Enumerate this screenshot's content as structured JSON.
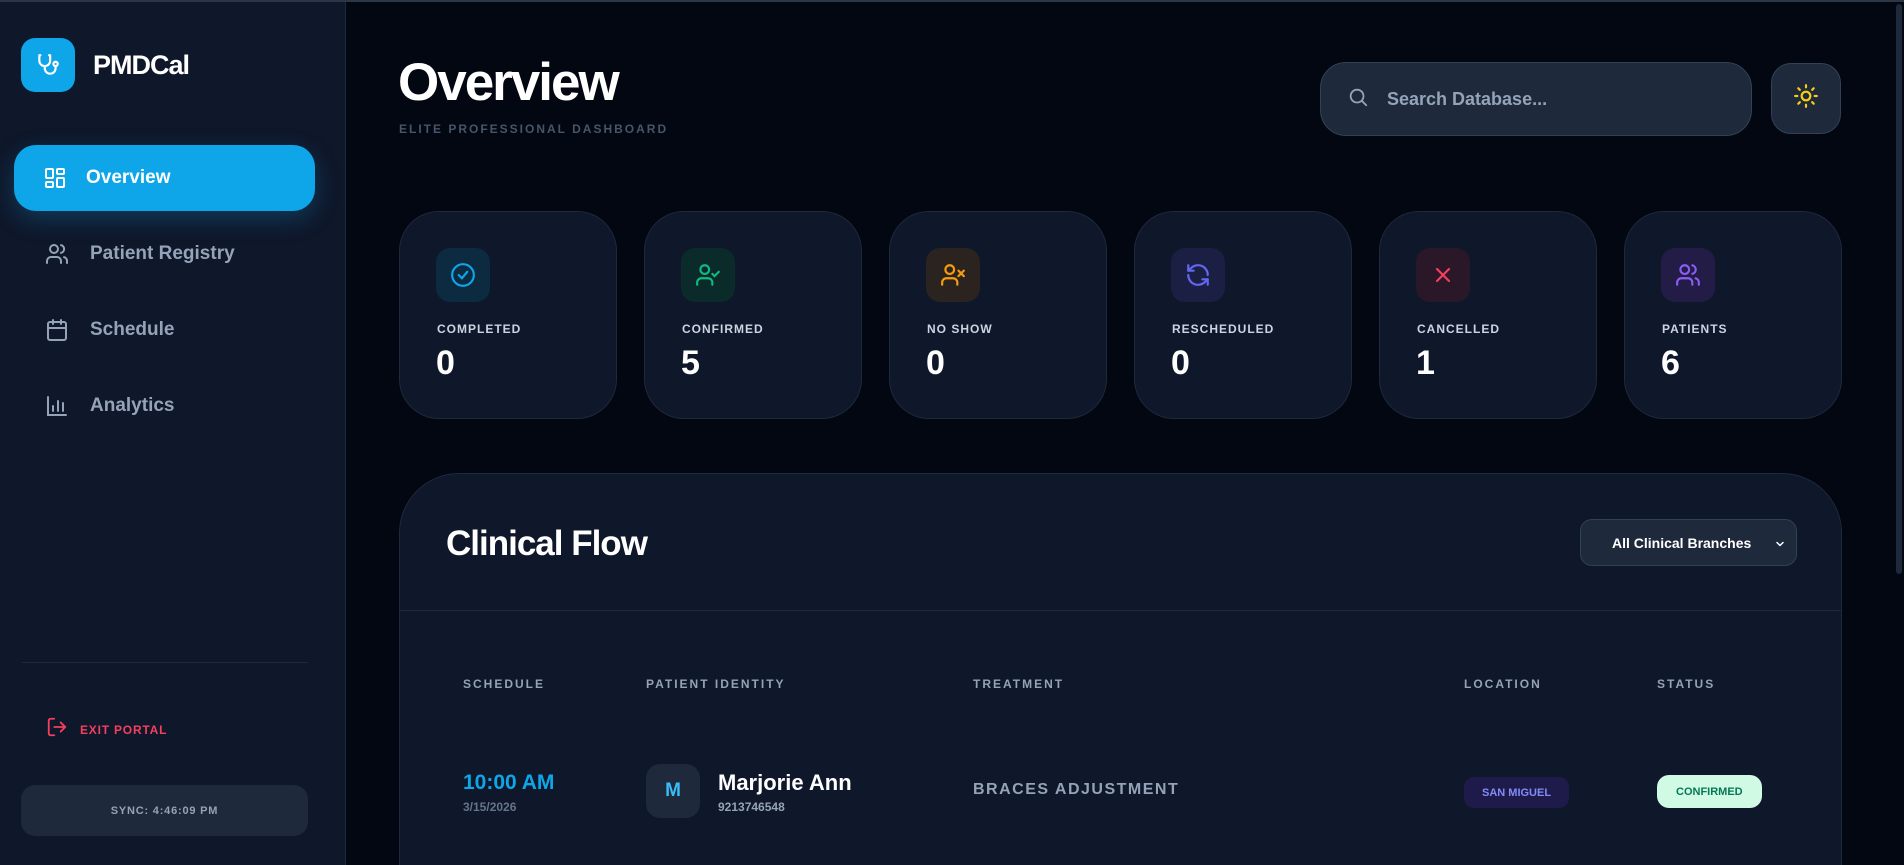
{
  "brand": {
    "name": "PMDCal",
    "icon": "stethoscope-icon"
  },
  "nav": [
    {
      "label": "Overview",
      "icon": "dashboard-grid-icon",
      "active": true
    },
    {
      "label": "Patient Registry",
      "icon": "users-icon",
      "active": false
    },
    {
      "label": "Schedule",
      "icon": "calendar-icon",
      "active": false
    },
    {
      "label": "Analytics",
      "icon": "bar-chart-icon",
      "active": false
    }
  ],
  "exit_label": "EXIT PORTAL",
  "sync_label": "SYNC: 4:46:09 PM",
  "header": {
    "title": "Overview",
    "subtitle": "ELITE PROFESSIONAL DASHBOARD",
    "search_placeholder": "Search Database..."
  },
  "stats": [
    {
      "label": "COMPLETED",
      "value": "0",
      "icon": "check-circle-icon",
      "color": "#0ea5e9"
    },
    {
      "label": "CONFIRMED",
      "value": "5",
      "icon": "user-check-icon",
      "color": "#10b981"
    },
    {
      "label": "NO SHOW",
      "value": "0",
      "icon": "user-x-icon",
      "color": "#f59e0b"
    },
    {
      "label": "RESCHEDULED",
      "value": "0",
      "icon": "refresh-icon",
      "color": "#6366f1"
    },
    {
      "label": "CANCELLED",
      "value": "1",
      "icon": "x-icon",
      "color": "#f43f5e"
    },
    {
      "label": "PATIENTS",
      "value": "6",
      "icon": "users-icon",
      "color": "#8b5cf6"
    }
  ],
  "clinical_flow": {
    "title": "Clinical Flow",
    "branch_selected": "All Clinical Branches",
    "columns": [
      "SCHEDULE",
      "PATIENT IDENTITY",
      "TREATMENT",
      "LOCATION",
      "STATUS"
    ],
    "rows": [
      {
        "time": "10:00 AM",
        "date": "3/15/2026",
        "initial": "M",
        "name": "Marjorie Ann",
        "phone": "9213746548",
        "treatment": "BRACES ADJUSTMENT",
        "location": "SAN MIGUEL",
        "status": "CONFIRMED"
      }
    ]
  },
  "colors": {
    "accent": "#0ea5e9",
    "background": "#030712",
    "panel": "#0f172a"
  }
}
